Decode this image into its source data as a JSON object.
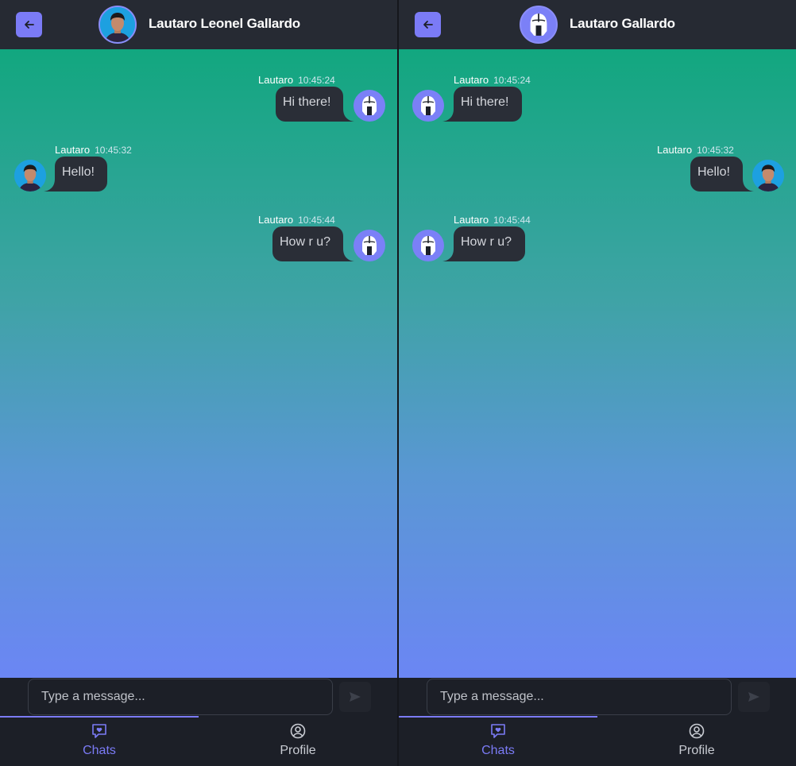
{
  "colors": {
    "accent": "#7b7bf6",
    "header_bg": "#262a33",
    "bubble_bg": "#2a2e37",
    "gradient_top": "#12a77f",
    "gradient_bottom": "#6b86f4"
  },
  "panes": [
    {
      "header": {
        "title": "Lautaro Leonel Gallardo",
        "avatar": "user-photo-avatar",
        "back_icon": "arrow-left-icon"
      },
      "messages": [
        {
          "direction": "sent",
          "sender": "Lautaro",
          "time": "10:45:24",
          "text": "Hi there!",
          "avatar": "spartan-helmet-avatar"
        },
        {
          "direction": "received",
          "sender": "Lautaro",
          "time": "10:45:32",
          "text": "Hello!",
          "avatar": "user-photo-avatar"
        },
        {
          "direction": "sent",
          "sender": "Lautaro",
          "time": "10:45:44",
          "text": "How r u?",
          "avatar": "spartan-helmet-avatar"
        }
      ],
      "composer": {
        "placeholder": "Type a message...",
        "send_icon": "send-icon"
      },
      "nav": {
        "chats_label": "Chats",
        "profile_label": "Profile",
        "active": "Chats"
      }
    },
    {
      "header": {
        "title": "Lautaro Gallardo",
        "avatar": "spartan-helmet-avatar",
        "back_icon": "arrow-left-icon"
      },
      "messages": [
        {
          "direction": "received",
          "sender": "Lautaro",
          "time": "10:45:24",
          "text": "Hi there!",
          "avatar": "spartan-helmet-avatar"
        },
        {
          "direction": "sent",
          "sender": "Lautaro",
          "time": "10:45:32",
          "text": "Hello!",
          "avatar": "user-photo-avatar"
        },
        {
          "direction": "received",
          "sender": "Lautaro",
          "time": "10:45:44",
          "text": "How r u?",
          "avatar": "spartan-helmet-avatar"
        }
      ],
      "composer": {
        "placeholder": "Type a message...",
        "send_icon": "send-icon"
      },
      "nav": {
        "chats_label": "Chats",
        "profile_label": "Profile",
        "active": "Chats"
      }
    }
  ]
}
